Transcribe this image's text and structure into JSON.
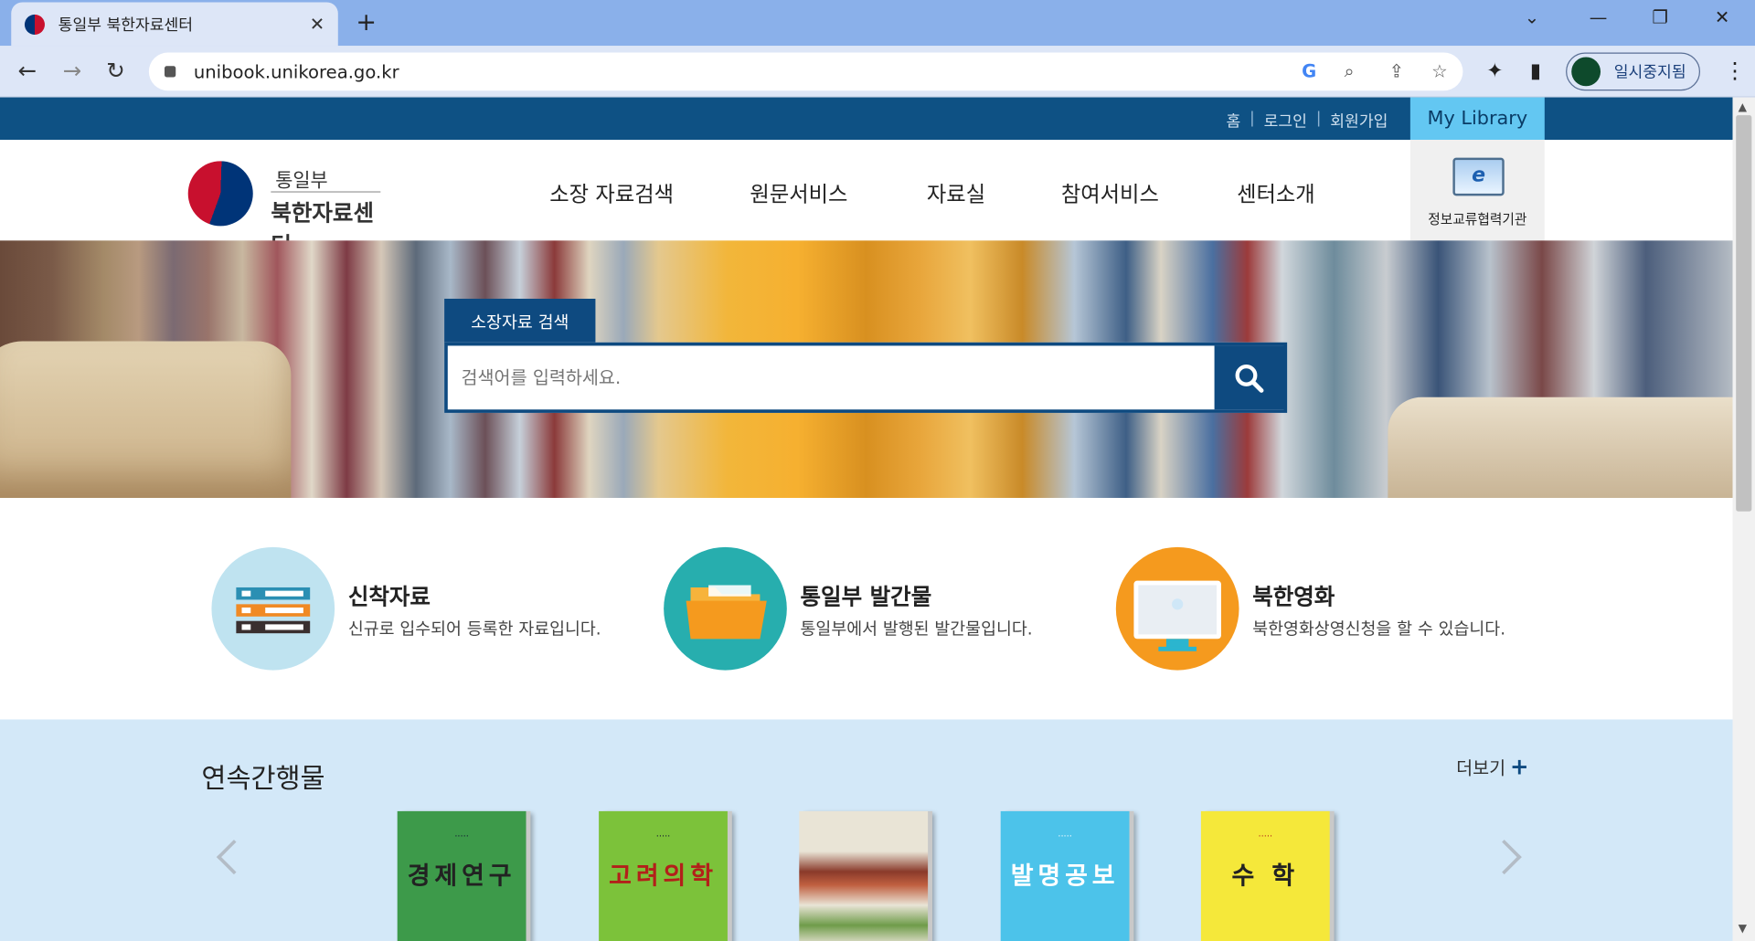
{
  "browser": {
    "tab_title": "통일부 북한자료센터",
    "url": "unibook.unikorea.go.kr",
    "profile_label": "일시중지됨"
  },
  "topbar": {
    "links": [
      "홈",
      "로그인",
      "회원가입"
    ],
    "my_library": "My Library"
  },
  "header": {
    "logo_line1": "통일부",
    "logo_line2": "북한자료센터",
    "nav": [
      "소장 자료검색",
      "원문서비스",
      "자료실",
      "참여서비스",
      "센터소개"
    ],
    "partner_label": "정보교류협력기관"
  },
  "search": {
    "tab_label": "소장자료 검색",
    "placeholder": "검색어를 입력하세요."
  },
  "quick_links": [
    {
      "title": "신착자료",
      "desc": "신규로 입수되어 등록한 자료입니다.",
      "icon": "bookshelf-icon",
      "color": "#bfe3f0"
    },
    {
      "title": "통일부 발간물",
      "desc": "통일부에서 발행된 발간물입니다.",
      "icon": "folder-icon",
      "color": "#27aeae"
    },
    {
      "title": "북한영화",
      "desc": "북한영화상영신청을 할 수 있습니다.",
      "icon": "monitor-icon",
      "color": "#f59a1e"
    }
  ],
  "serials": {
    "title": "연속간행물",
    "more_label": "더보기",
    "items": [
      {
        "cover_title": "경제연구",
        "color": "#3d9a4a"
      },
      {
        "cover_title": "고려의학",
        "color": "#7cc23a"
      },
      {
        "cover_title": "",
        "color": "#e9e4d6"
      },
      {
        "cover_title": "발명공보",
        "color": "#4cc3ea"
      },
      {
        "cover_title": "수 학",
        "color": "#f5e83a"
      }
    ]
  }
}
